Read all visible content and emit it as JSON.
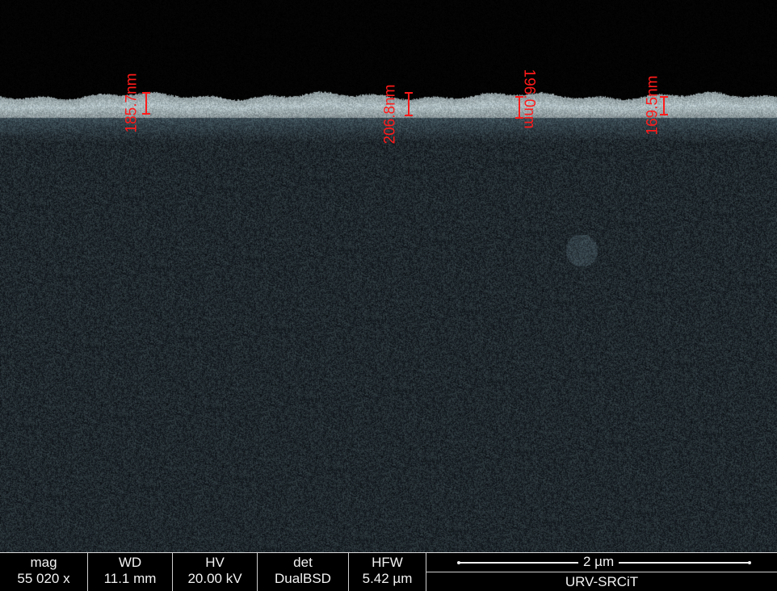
{
  "micrograph": {
    "measurements": [
      "185.7nm",
      "206.8nm",
      "196.0nm",
      "169.5nm"
    ]
  },
  "databar": {
    "mag_label": "mag",
    "mag_value": "55 020 x",
    "wd_label": "WD",
    "wd_value": "11.1 mm",
    "hv_label": "HV",
    "hv_value": "20.00 kV",
    "det_label": "det",
    "det_value": "DualBSD",
    "hfw_label": "HFW",
    "hfw_value": "5.42 µm",
    "scale_label": "2 µm",
    "institute": "URV-SRCiT"
  },
  "colors": {
    "annotation": "#ff1a1a",
    "film": "#b8c6cc",
    "substrate": "#27323a"
  }
}
